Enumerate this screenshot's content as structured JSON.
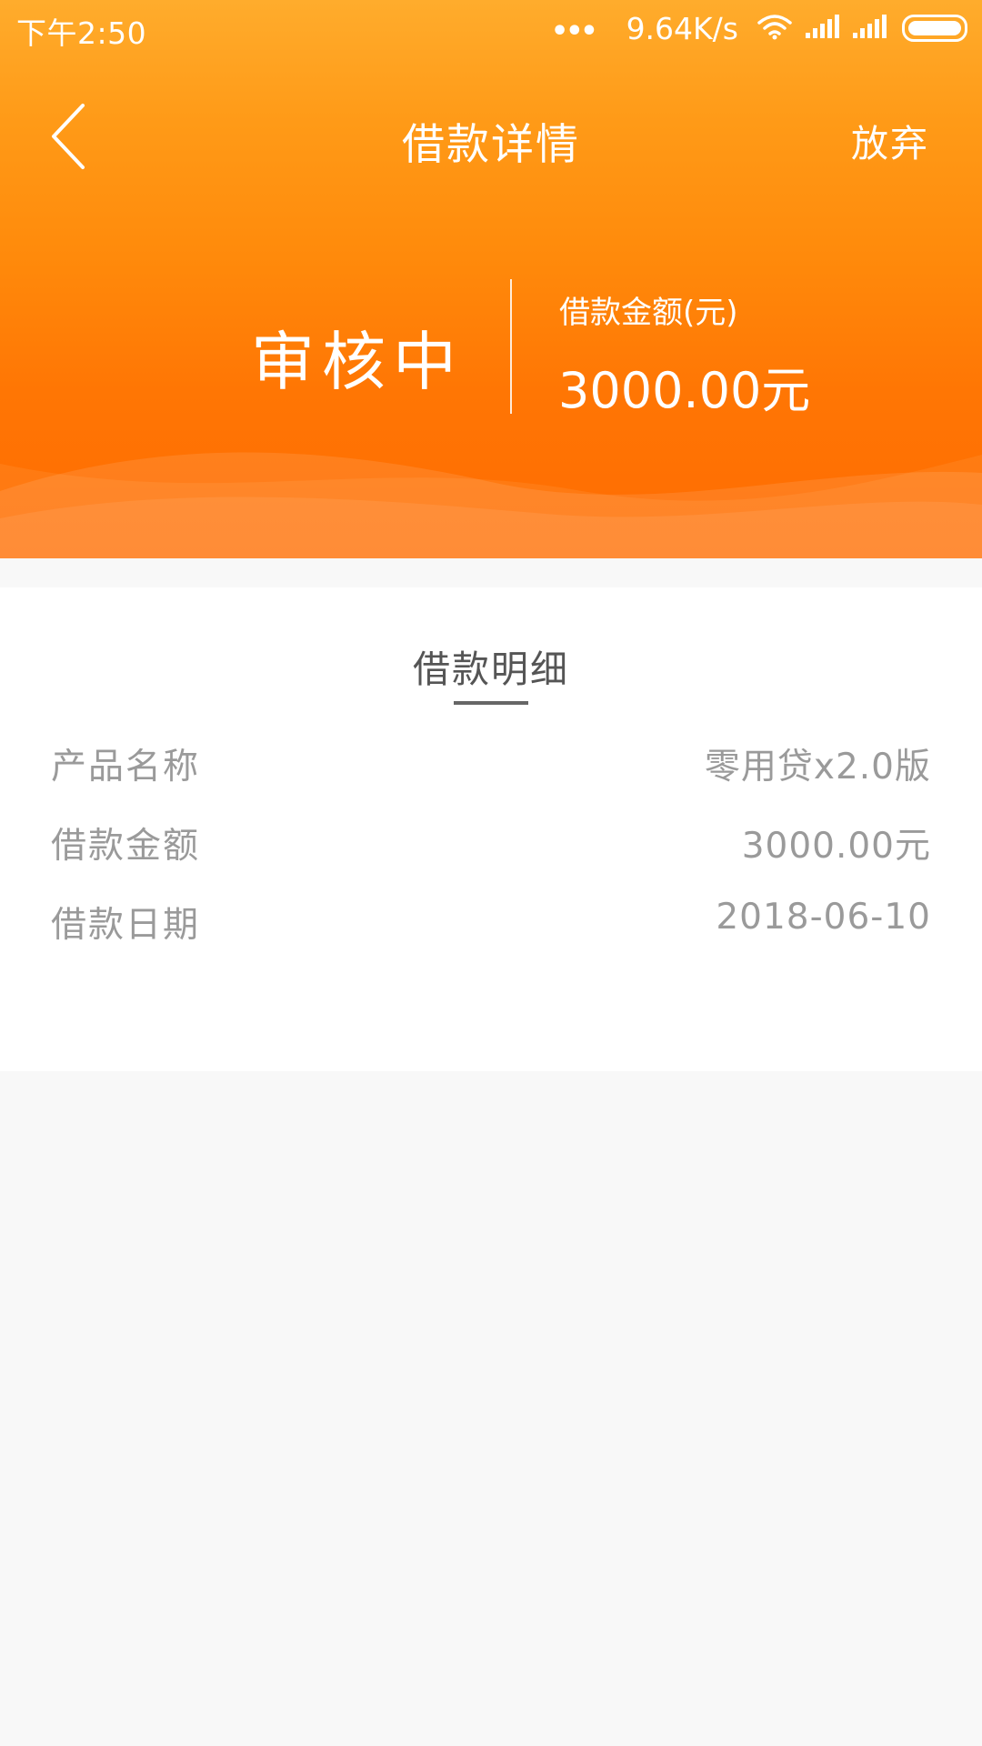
{
  "status_bar": {
    "time": "下午2:50",
    "dots": "•••",
    "network_speed": "9.64K/s",
    "icons": [
      "wifi-icon",
      "signal-icon",
      "signal-icon",
      "battery-icon"
    ]
  },
  "nav": {
    "back_icon": "chevron-left-icon",
    "title": "借款详情",
    "action_label": "放弃"
  },
  "summary": {
    "status": "审核中",
    "amount_label": "借款金额(元)",
    "amount_value": "3000.00元"
  },
  "details": {
    "title": "借款明细",
    "rows": [
      {
        "label": "产品名称",
        "value": "零用贷x2.0版"
      },
      {
        "label": "借款金额",
        "value": "3000.00元"
      },
      {
        "label": "借款日期",
        "value": "2018-06-10"
      }
    ]
  },
  "colors": {
    "header_gradient_top": "#ffac2c",
    "header_gradient_bottom": "#ff6b02",
    "page_background": "#f8f8f8",
    "card_background": "#ffffff",
    "label_text": "#9a9a9a",
    "title_text": "#555555"
  }
}
